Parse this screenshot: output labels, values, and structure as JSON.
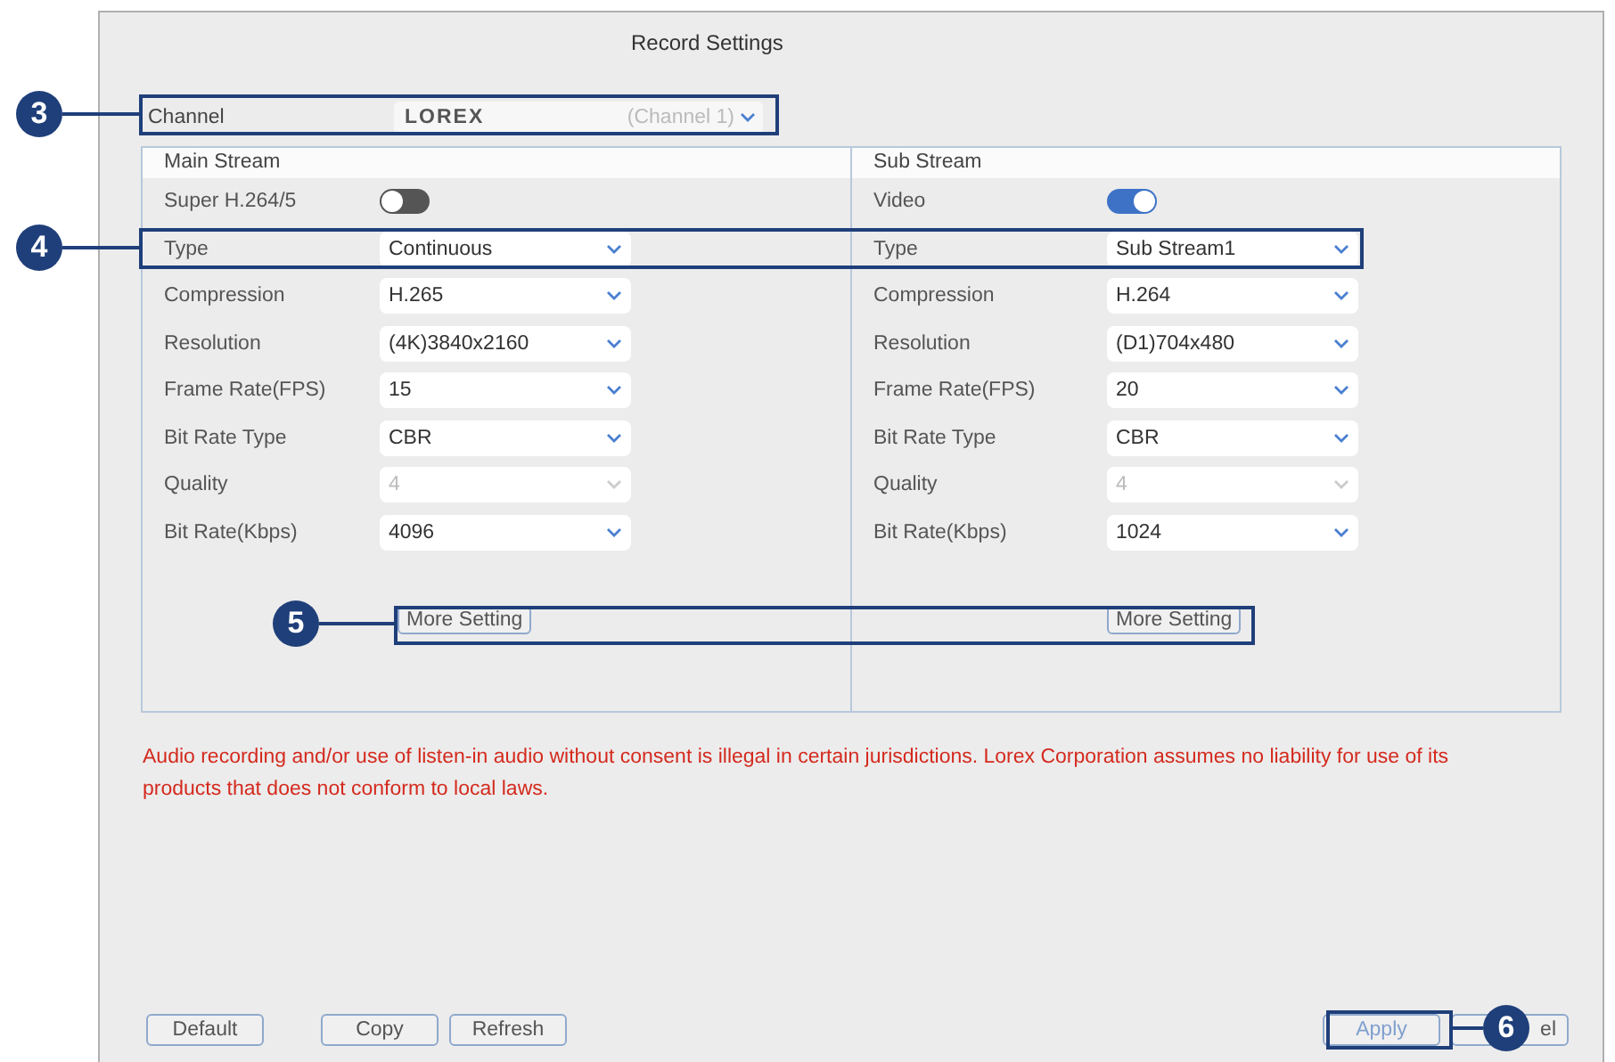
{
  "window": {
    "title": "Record Settings"
  },
  "channel": {
    "label": "Channel",
    "value": "LOREX",
    "hint": "(Channel 1)"
  },
  "streams": [
    {
      "title": "Main Stream",
      "more_button": "More Setting",
      "rows": [
        {
          "kind": "toggle",
          "label": "Super H.264/5",
          "on": false
        },
        {
          "kind": "select",
          "label": "Type",
          "value": "Continuous",
          "disabled": false
        },
        {
          "kind": "select",
          "label": "Compression",
          "value": "H.265",
          "disabled": false
        },
        {
          "kind": "select",
          "label": "Resolution",
          "value": "(4K)3840x2160",
          "disabled": false
        },
        {
          "kind": "select",
          "label": "Frame Rate(FPS)",
          "value": "15",
          "disabled": false
        },
        {
          "kind": "select",
          "label": "Bit Rate Type",
          "value": "CBR",
          "disabled": false
        },
        {
          "kind": "select",
          "label": "Quality",
          "value": "4",
          "disabled": true
        },
        {
          "kind": "select",
          "label": "Bit Rate(Kbps)",
          "value": "4096",
          "disabled": false
        }
      ]
    },
    {
      "title": "Sub Stream",
      "more_button": "More Setting",
      "rows": [
        {
          "kind": "toggle",
          "label": "Video",
          "on": true
        },
        {
          "kind": "select",
          "label": "Type",
          "value": "Sub Stream1",
          "disabled": false
        },
        {
          "kind": "select",
          "label": "Compression",
          "value": "H.264",
          "disabled": false
        },
        {
          "kind": "select",
          "label": "Resolution",
          "value": "(D1)704x480",
          "disabled": false
        },
        {
          "kind": "select",
          "label": "Frame Rate(FPS)",
          "value": "20",
          "disabled": false
        },
        {
          "kind": "select",
          "label": "Bit Rate Type",
          "value": "CBR",
          "disabled": false
        },
        {
          "kind": "select",
          "label": "Quality",
          "value": "4",
          "disabled": true
        },
        {
          "kind": "select",
          "label": "Bit Rate(Kbps)",
          "value": "1024",
          "disabled": false
        }
      ]
    }
  ],
  "warning": "Audio recording and/or use of listen-in audio without consent is illegal in certain jurisdictions. Lorex Corporation assumes no liability for use of its products that does not conform to local laws.",
  "buttons_left": [
    {
      "label": "Default",
      "disabled": false
    },
    {
      "label": "Copy",
      "disabled": false
    },
    {
      "label": "Refresh",
      "disabled": false
    }
  ],
  "buttons_right": [
    {
      "label": "Apply",
      "disabled": true
    },
    {
      "label": "el",
      "disabled": false
    }
  ],
  "callouts": [
    {
      "number": "3"
    },
    {
      "number": "4"
    },
    {
      "number": "5"
    },
    {
      "number": "6"
    }
  ]
}
